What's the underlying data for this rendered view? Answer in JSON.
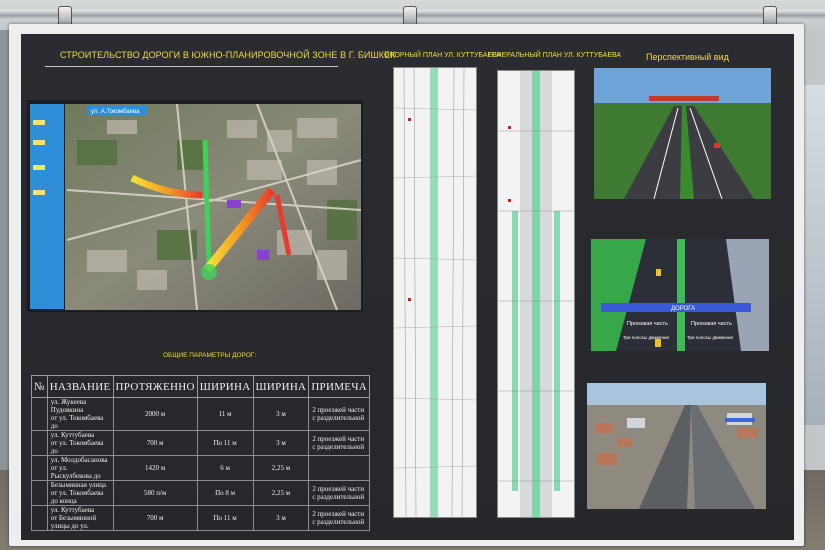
{
  "board": {
    "title": "СТРОИТЕЛЬСТВО ДОРОГИ В ЮЖНО-ПЛАНИРОВОЧНОЙ ЗОНЕ В Г. БИШКЕК",
    "support_plan_title": "ОПОРНЫЙ ПЛАН УЛ. КУТТУБАЕВА",
    "general_plan_title": "ГЕНЕРАЛЬНЫЙ ПЛАН УЛ. КУТТУБАЕВА",
    "perspective_title": "Перспективный вид",
    "params_title": "ОБЩИЕ ПАРАМЕТРЫ ДОРОГ:",
    "map_label": "ул. А.Токомбаева",
    "render_labels": {
      "roadway_left": "Проезжая часть",
      "roadway_right": "Проезжая часть",
      "lanes_left": "Три полосы движения",
      "lanes_right": "Три полосы движения",
      "road": "ДОРОГА"
    }
  },
  "table": {
    "headers": [
      "№",
      "НАЗВАНИЕ",
      "ПРОТЯЖЕННО",
      "ШИРИНА",
      "ШИРИНА",
      "ПРИМЕЧА"
    ],
    "rows": [
      {
        "name": "ул. Жукеева Пудовкина\nот ул. Токомбаева до",
        "length": "2000 м",
        "width1": "11 м",
        "width2": "3 м",
        "note": "2 проезжей части\nс разделительной"
      },
      {
        "name": "ул. Куттубаева\nот ул. Токомбаева до",
        "length": "700 м",
        "width1": "По 11 м",
        "width2": "3 м",
        "note": "2 проезжей части\nс разделительной"
      },
      {
        "name": "ул. Молдобасанова\nот ул. Рыскулбекова до",
        "length": "1420 м",
        "width1": "6 м",
        "width2": "2,25 м",
        "note": ""
      },
      {
        "name": "Безымянная улица\nот ул. Токомбаева до конца",
        "length": "580 п/м",
        "width1": "По 8 м",
        "width2": "2,25 м",
        "note": "2 проезжей части\nс разделительной"
      },
      {
        "name": "ул. Куттубаева\nот Безымянной улицы до ул.",
        "length": "700 м",
        "width1": "По 11 м",
        "width2": "3 м",
        "note": "2 проезжей части\nс разделительной"
      }
    ]
  },
  "colors": {
    "board": "#26282c",
    "title_yellow": "#f4dc3a",
    "legend_blue": "#2e8ed8",
    "plan_green": "#7fd6a8"
  }
}
